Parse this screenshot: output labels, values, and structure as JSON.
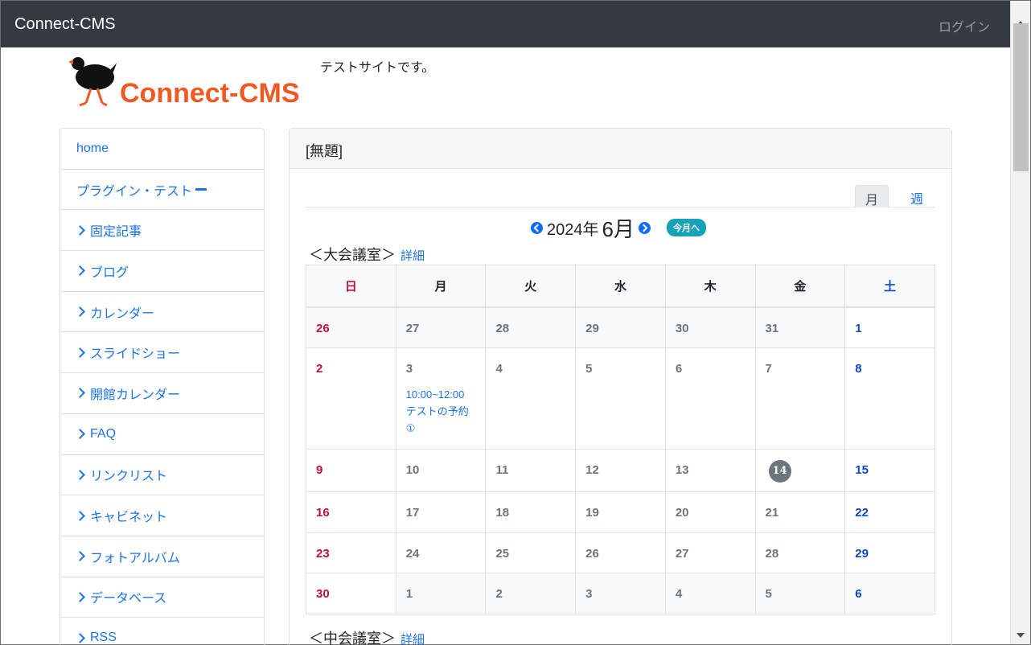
{
  "navbar": {
    "brand": "Connect-CMS",
    "login": "ログイン"
  },
  "header": {
    "logo_text_1": "Connect-",
    "logo_text_2": "CMS",
    "description": "テストサイトです。"
  },
  "sidebar": {
    "items": [
      {
        "label": "home"
      },
      {
        "label": "プラグイン・テスト"
      },
      {
        "label": "固定記事"
      },
      {
        "label": "ブログ"
      },
      {
        "label": "カレンダー"
      },
      {
        "label": "スライドショー"
      },
      {
        "label": "開館カレンダー"
      },
      {
        "label": "FAQ"
      },
      {
        "label": "リンクリスト"
      },
      {
        "label": "キャビネット"
      },
      {
        "label": "フォトアルバム"
      },
      {
        "label": "データベース"
      },
      {
        "label": "RSS"
      }
    ]
  },
  "main": {
    "card_title": "[無題]",
    "tabs": {
      "month": "月",
      "week": "週"
    },
    "nav": {
      "year": "2024年",
      "month": "6月",
      "today": "今月へ"
    },
    "rooms": [
      {
        "name": "＜大会議室＞",
        "detail": "詳細"
      },
      {
        "name": "＜中会議室＞",
        "detail": "詳細"
      }
    ],
    "weekdays": [
      "日",
      "月",
      "火",
      "水",
      "木",
      "金",
      "土"
    ],
    "weeks": [
      [
        "26",
        "27",
        "28",
        "29",
        "30",
        "31",
        "1"
      ],
      [
        "2",
        "3",
        "4",
        "5",
        "6",
        "7",
        "8"
      ],
      [
        "9",
        "10",
        "11",
        "12",
        "13",
        "14",
        "15"
      ],
      [
        "16",
        "17",
        "18",
        "19",
        "20",
        "21",
        "22"
      ],
      [
        "23",
        "24",
        "25",
        "26",
        "27",
        "28",
        "29"
      ],
      [
        "30",
        "1",
        "2",
        "3",
        "4",
        "5",
        "6"
      ]
    ],
    "event": {
      "time": "10:00~12:00",
      "title": "テストの予約①"
    }
  },
  "colors": {
    "navbar_bg": "#343a40",
    "link": "#1a73e8",
    "sunday": "#c20e3a",
    "saturday": "#0d47c9",
    "today_badge": "#17a2b8",
    "logo_orange": "#f05a22"
  }
}
